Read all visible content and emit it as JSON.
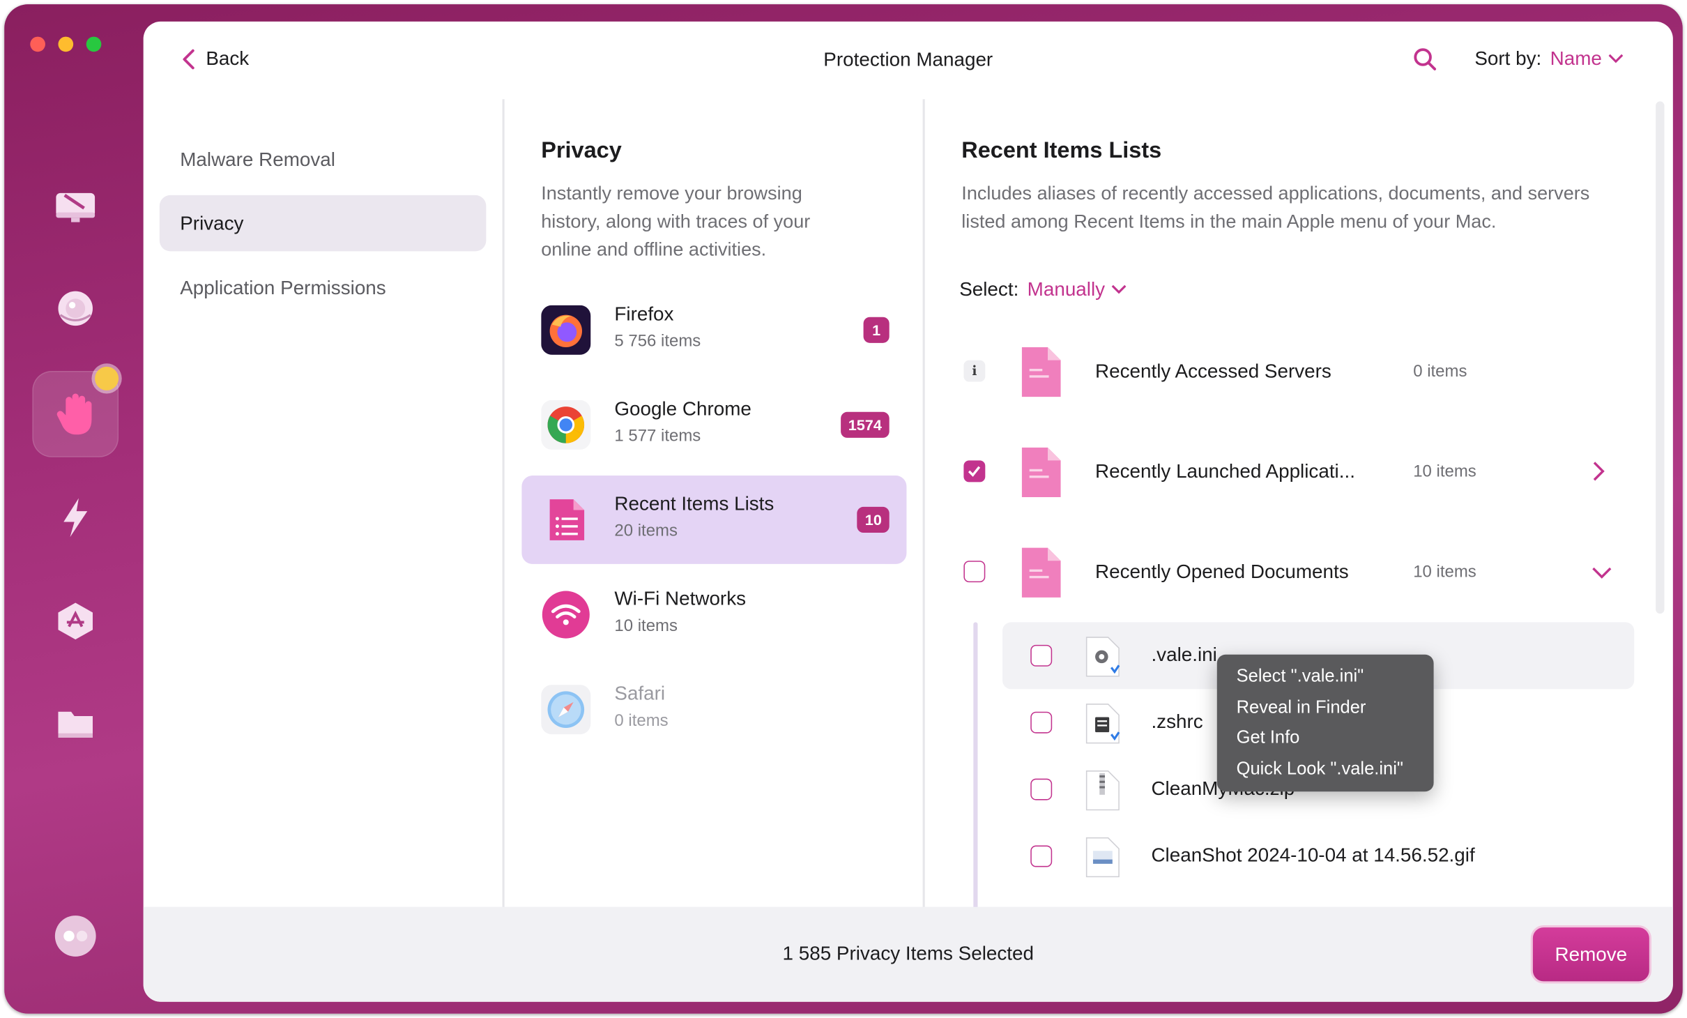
{
  "header": {
    "back_label": "Back",
    "title": "Protection Manager",
    "sort_label": "Sort by:",
    "sort_value": "Name"
  },
  "sidebar_nav": {
    "items": [
      {
        "label": "Malware Removal"
      },
      {
        "label": "Privacy"
      },
      {
        "label": "Application Permissions"
      }
    ]
  },
  "dock": {
    "icons": [
      "smart-care-icon",
      "protection-shield-icon",
      "privacy-hand-icon",
      "speed-bolt-icon",
      "applications-icon",
      "files-folder-icon",
      "assistant-icon"
    ]
  },
  "privacy": {
    "title": "Privacy",
    "description": "Instantly remove your browsing history, along with traces of your online and offline activities.",
    "apps": [
      {
        "name": "Firefox",
        "count": "5 756 items",
        "badge": "1"
      },
      {
        "name": "Google Chrome",
        "count": "1 577 items",
        "badge": "1574"
      },
      {
        "name": "Recent Items Lists",
        "count": "20 items",
        "badge": "10"
      },
      {
        "name": "Wi-Fi Networks",
        "count": "10 items",
        "badge": ""
      },
      {
        "name": "Safari",
        "count": "0 items",
        "badge": ""
      }
    ]
  },
  "recent": {
    "title": "Recent Items Lists",
    "description": "Includes aliases of recently accessed applications, documents, and servers listed among Recent Items in the main Apple menu of your Mac.",
    "select_label": "Select:",
    "select_value": "Manually",
    "categories": [
      {
        "name": "Recently Accessed Servers",
        "count": "0 items"
      },
      {
        "name": "Recently Launched Applicati...",
        "count": "10 items"
      },
      {
        "name": "Recently Opened Documents",
        "count": "10 items"
      }
    ],
    "files": [
      {
        "name": ".vale.ini"
      },
      {
        "name": ".zshrc"
      },
      {
        "name": "CleanMyMac.zip"
      },
      {
        "name": "CleanShot 2024-10-04 at 14.56.52.gif"
      }
    ]
  },
  "context_menu": {
    "items": [
      "Select \".vale.ini\"",
      "Reveal in Finder",
      "Get Info",
      "Quick Look \".vale.ini\""
    ]
  },
  "footer": {
    "summary": "1 585 Privacy Items Selected",
    "remove_label": "Remove"
  },
  "colors": {
    "accent": "#c2338e",
    "sidebar": "#a22e78",
    "selected_row": "#e4d4f5"
  }
}
